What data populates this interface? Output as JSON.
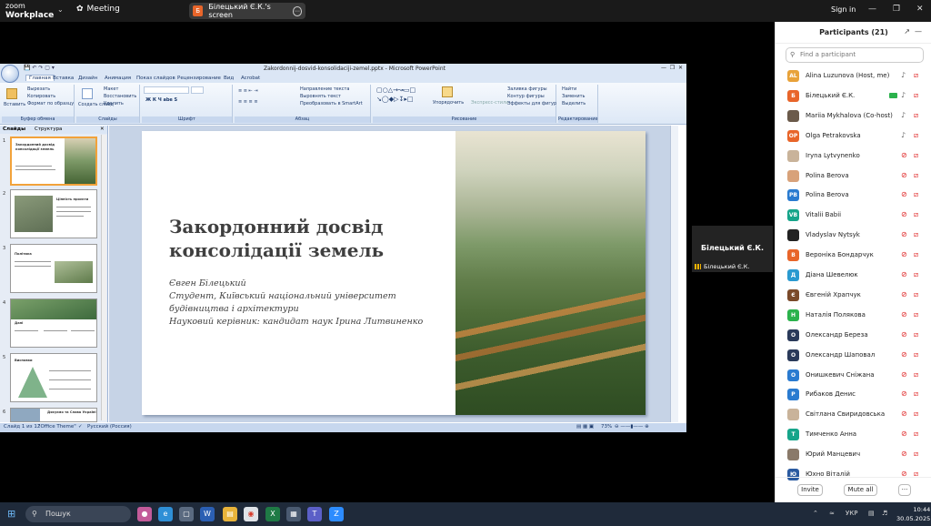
{
  "zoom": {
    "brand_top": "zoom",
    "brand_bottom": "Workplace",
    "meeting_label": "Meeting",
    "screen_owner_badge": "Б",
    "screen_label": "Білецький Є.К.'s screen",
    "signin_label": "Sign in"
  },
  "ppt": {
    "window_title": "Zakordonnij-dosvid-konsolidaciji-zemel.pptx - Microsoft PowerPoint",
    "tabs": [
      "Главная",
      "Вставка",
      "Дизайн",
      "Анимация",
      "Показ слайдов",
      "Рецензирование",
      "Вид",
      "Acrobat"
    ],
    "ribbon": {
      "paste": "Вставить",
      "cut": "Вырезать",
      "copy": "Копировать",
      "format_painter": "Формат по образцу",
      "clipboard_group": "Буфер обмена",
      "new_slide": "Создать слайд",
      "layout": "Макет",
      "reset": "Восстановить",
      "delete": "Удалить",
      "slides_group": "Слайды",
      "font_group": "Шрифт",
      "text_direction": "Направление текста",
      "align_text": "Выровнять текст",
      "smartart": "Преобразовать в SmartArt",
      "paragraph_group": "Абзац",
      "arrange": "Упорядочить",
      "quick_styles": "Экспресс-стили",
      "shape_fill": "Заливка фигуры",
      "shape_outline": "Контур фигуры",
      "shape_effects": "Эффекты для фигур",
      "drawing_group": "Рисование",
      "find": "Найти",
      "replace": "Заменить",
      "select": "Выделить",
      "editing_group": "Редактирование"
    },
    "panel_tabs": [
      "Слайды",
      "Структура"
    ],
    "thumbs": [
      {
        "num": "1",
        "title": "Закордонний досвід консолідації земель"
      },
      {
        "num": "2",
        "title": "Цінність проєкти"
      },
      {
        "num": "3",
        "title": "Політика"
      },
      {
        "num": "4",
        "title": "Дані"
      },
      {
        "num": "5",
        "title": "Висновки"
      },
      {
        "num": "6",
        "title": "Дякуємо та Слава Україні"
      }
    ],
    "slide": {
      "title": "Закордонний досвід консолідації земель",
      "subtitle_lines": [
        "Євген Білецький",
        "Студент, Київський національний університет",
        "будівництва і архітектури",
        "Науковий керівник: кандидат наук Ірина Литвиненко"
      ]
    },
    "status": {
      "slide_of": "Слайд 1 из 12",
      "theme": "\"Office Theme\"",
      "language": "Русский (Россия)",
      "zoom": "73%"
    }
  },
  "video_tile": {
    "name": "Білецький Є.К.",
    "label": "Білецький Є.К."
  },
  "participants": {
    "title": "Participants (21)",
    "search_placeholder": "Find a participant",
    "list": [
      {
        "name": "Alina Luzunova (Host, me)",
        "initials": "AL",
        "color": "#e8a23a",
        "mic": "on",
        "cam": "off"
      },
      {
        "name": "Білецький Є.К.",
        "initials": "Б",
        "color": "#e8652a",
        "mic": "on",
        "cam": "green"
      },
      {
        "name": "Mariia Mykhalova (Co-host)",
        "initials": "",
        "color": "#6b5a4a",
        "mic": "on",
        "cam": "off"
      },
      {
        "name": "Olga Petrakovska",
        "initials": "OP",
        "color": "#e8652a",
        "mic": "on",
        "cam": "off"
      },
      {
        "name": "Iryna Lytvynenko",
        "initials": "",
        "color": "#c9b39a",
        "mic": "off",
        "cam": "off"
      },
      {
        "name": "Polina Berova",
        "initials": "",
        "color": "#d8a27a",
        "mic": "off",
        "cam": "off"
      },
      {
        "name": "Polina Berova",
        "initials": "PB",
        "color": "#2a7bd0",
        "mic": "off",
        "cam": "off"
      },
      {
        "name": "Vitalii Babii",
        "initials": "VB",
        "color": "#16a58a",
        "mic": "off",
        "cam": "off"
      },
      {
        "name": "Vladyslav Nytsyk",
        "initials": "",
        "color": "#222222",
        "mic": "off",
        "cam": "off"
      },
      {
        "name": "Вероніка Бондарчук",
        "initials": "В",
        "color": "#e8652a",
        "mic": "off",
        "cam": "off"
      },
      {
        "name": "Діана Шевелюк",
        "initials": "Д",
        "color": "#2a9ad0",
        "mic": "off",
        "cam": "off"
      },
      {
        "name": "Євгеній Храпчук",
        "initials": "Є",
        "color": "#7a4a2a",
        "mic": "off",
        "cam": "off"
      },
      {
        "name": "Наталія Полякова",
        "initials": "Н",
        "color": "#2bb24c",
        "mic": "off",
        "cam": "off"
      },
      {
        "name": "Олександр Береза",
        "initials": "О",
        "color": "#2a3a5a",
        "mic": "off",
        "cam": "off"
      },
      {
        "name": "Олександр Шаповал",
        "initials": "О",
        "color": "#2a3a5a",
        "mic": "off",
        "cam": "off"
      },
      {
        "name": "Онишкевич Сніжана",
        "initials": "О",
        "color": "#2a7bd0",
        "mic": "off",
        "cam": "off"
      },
      {
        "name": "Рибаков Денис",
        "initials": "Р",
        "color": "#2a7bd0",
        "mic": "off",
        "cam": "off"
      },
      {
        "name": "Світлана Свиридовська",
        "initials": "",
        "color": "#c9b39a",
        "mic": "off",
        "cam": "off"
      },
      {
        "name": "Тимченко Анна",
        "initials": "Т",
        "color": "#16a58a",
        "mic": "off",
        "cam": "off"
      },
      {
        "name": "Юрий Манцевич",
        "initials": "",
        "color": "#8a7a6a",
        "mic": "off",
        "cam": "off"
      },
      {
        "name": "Юхно Віталій",
        "initials": "Ю",
        "color": "#2a5aa0",
        "mic": "off",
        "cam": "off"
      }
    ],
    "invite_label": "Invite",
    "mute_all_label": "Mute all",
    "more_label": "···"
  },
  "taskbar": {
    "search_placeholder": "Пошук",
    "language": "УКР",
    "time": "10:44",
    "date": "30.05.2025"
  }
}
